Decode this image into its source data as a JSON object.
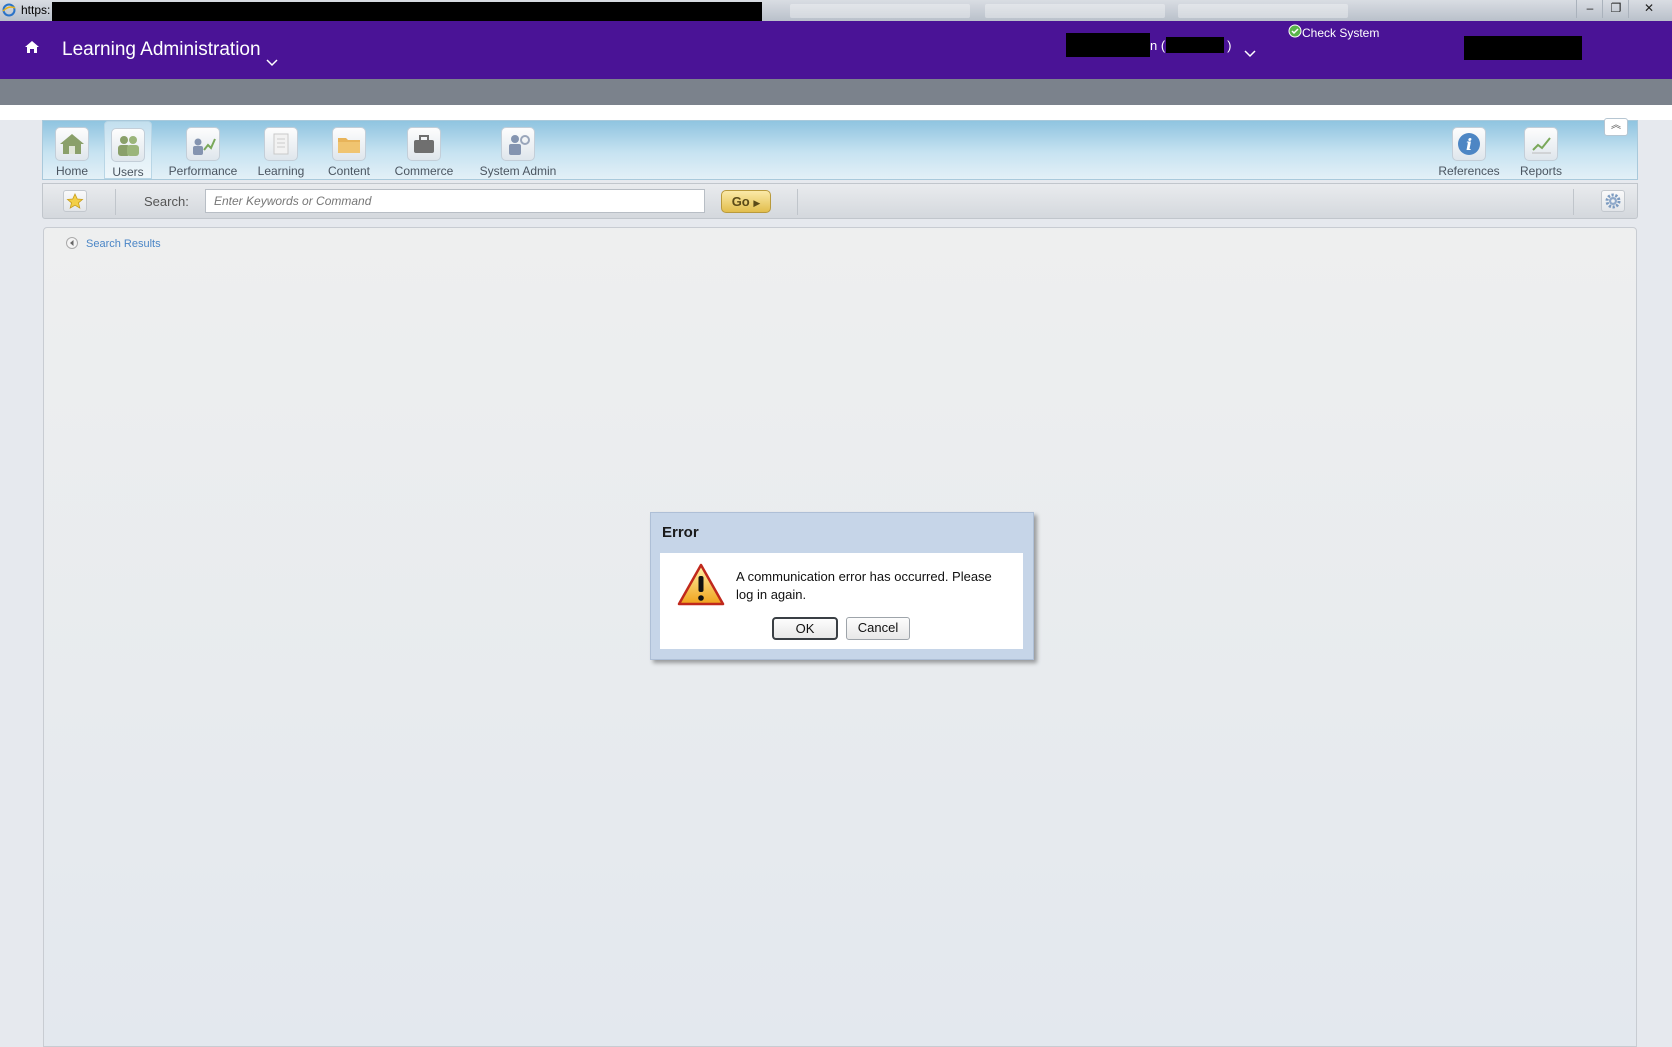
{
  "browser": {
    "url_prefix": "https:",
    "window_controls": {
      "minimize": "‒",
      "restore": "❐",
      "close": "✕"
    }
  },
  "header": {
    "title": "Learning Administration",
    "user_partial": "n (",
    "user_partial_end": ")",
    "check_system": "Check System",
    "background_color": "#4a1396"
  },
  "nav": {
    "items": [
      {
        "label": "Home",
        "icon": "home-icon"
      },
      {
        "label": "Users",
        "icon": "users-icon",
        "active": true
      },
      {
        "label": "Performance",
        "icon": "performance-icon"
      },
      {
        "label": "Learning",
        "icon": "learning-icon"
      },
      {
        "label": "Content",
        "icon": "content-icon"
      },
      {
        "label": "Commerce",
        "icon": "commerce-icon"
      },
      {
        "label": "System Admin",
        "icon": "system-admin-icon"
      }
    ],
    "right_items": [
      {
        "label": "References",
        "icon": "info-icon"
      },
      {
        "label": "Reports",
        "icon": "reports-icon"
      }
    ]
  },
  "search": {
    "label": "Search:",
    "placeholder": "Enter Keywords or Command",
    "go_label": "Go"
  },
  "content": {
    "back_link": "Search Results"
  },
  "dialog": {
    "title": "Error",
    "message": "A communication error has occurred.  Please log in again.",
    "ok_label": "OK",
    "cancel_label": "Cancel",
    "icon": "warning-icon"
  }
}
